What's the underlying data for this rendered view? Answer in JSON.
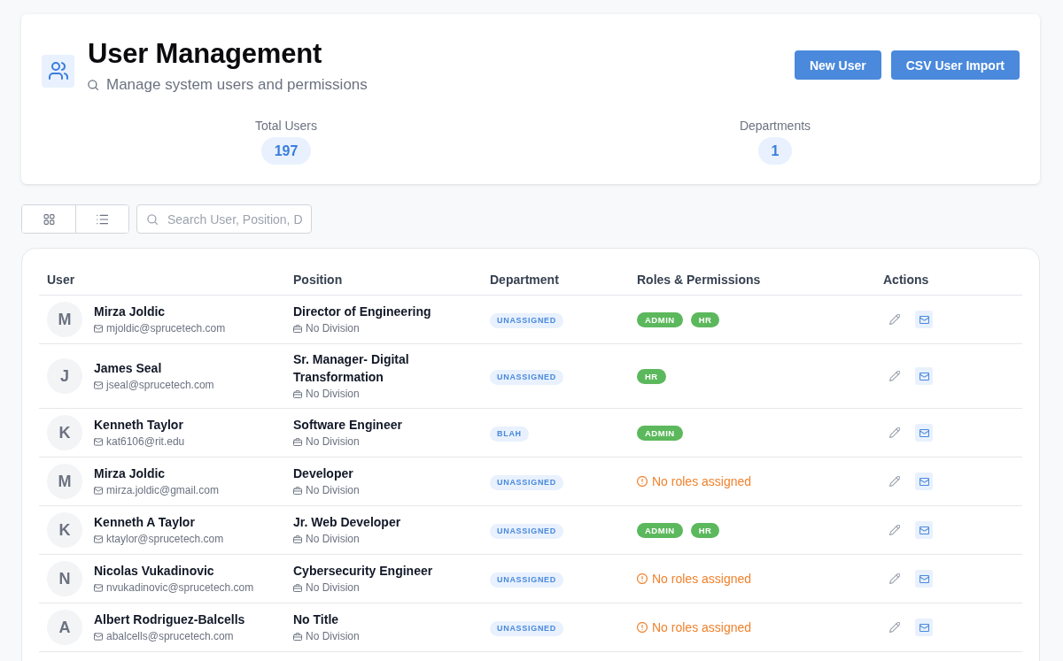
{
  "header": {
    "title": "User Management",
    "subtitle": "Manage system users and permissions",
    "buttons": [
      {
        "label": "New User"
      },
      {
        "label": "CSV User Import"
      }
    ]
  },
  "stats": [
    {
      "label": "Total Users",
      "value": "197"
    },
    {
      "label": "Departments",
      "value": "1"
    }
  ],
  "toolbar": {
    "view_toggle": [
      {
        "kind": "grid"
      },
      {
        "kind": "list"
      }
    ],
    "search": {
      "placeholder": "Search User, Position, D"
    }
  },
  "table": {
    "columns": [
      "User",
      "Position",
      "Department",
      "Roles & Permissions",
      "Actions"
    ],
    "rows": [
      {
        "initial": "M",
        "name": "Mirza Joldic",
        "email": "mjoldic@sprucetech.com",
        "position": "Director of Engineering",
        "division": "No Division",
        "department": "UNASSIGNED",
        "roles": [
          "ADMIN",
          "HR"
        ]
      },
      {
        "initial": "J",
        "name": "James Seal",
        "email": "jseal@sprucetech.com",
        "position": "Sr. Manager- Digital Transformation",
        "division": "No Division",
        "department": "UNASSIGNED",
        "roles": [
          "HR"
        ]
      },
      {
        "initial": "K",
        "name": "Kenneth Taylor",
        "email": "kat6106@rit.edu",
        "position": "Software Engineer",
        "division": "No Division",
        "department": "BLAH",
        "roles": [
          "ADMIN"
        ]
      },
      {
        "initial": "M",
        "name": "Mirza Joldic",
        "email": "mirza.joldic@gmail.com",
        "position": "Developer",
        "division": "No Division",
        "department": "UNASSIGNED",
        "roles_note": "No roles assigned"
      },
      {
        "initial": "K",
        "name": "Kenneth A Taylor",
        "email": "ktaylor@sprucetech.com",
        "position": "Jr. Web Developer",
        "division": "No Division",
        "department": "UNASSIGNED",
        "roles": [
          "ADMIN",
          "HR"
        ]
      },
      {
        "initial": "N",
        "name": "Nicolas Vukadinovic",
        "email": "nvukadinovic@sprucetech.com",
        "position": "Cybersecurity Engineer",
        "division": "No Division",
        "department": "UNASSIGNED",
        "roles_note": "No roles assigned"
      },
      {
        "initial": "A",
        "name": "Albert Rodriguez-Balcells",
        "email": "abalcells@sprucetech.com",
        "position": "No Title",
        "division": "No Division",
        "department": "UNASSIGNED",
        "roles_note": "No roles assigned"
      }
    ]
  }
}
